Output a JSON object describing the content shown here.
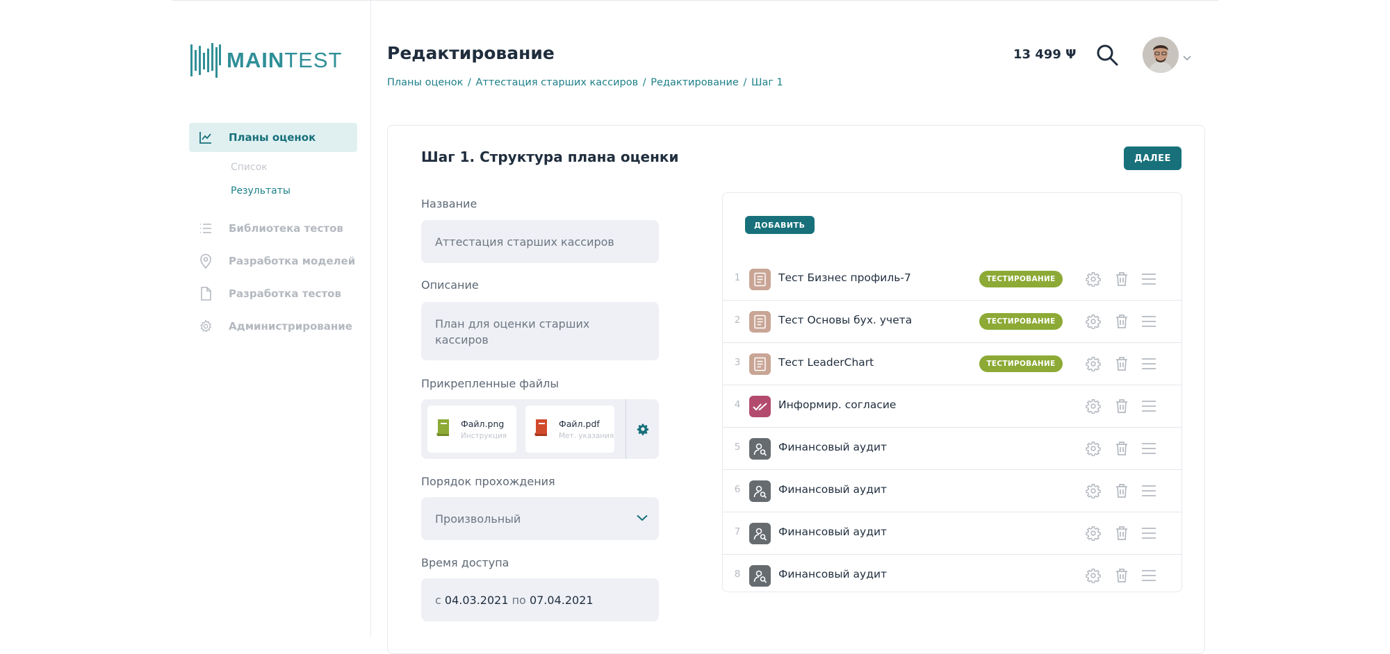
{
  "app": {
    "logo_text_bold": "MAIN",
    "logo_text_light": "TEST"
  },
  "sidebar": {
    "items": [
      {
        "label": "Планы оценок",
        "icon": "chart-line-icon",
        "active": true
      },
      {
        "label": "Библиотека тестов",
        "icon": "list-icon"
      },
      {
        "label": "Разработка моделей",
        "icon": "location-pin-icon"
      },
      {
        "label": "Разработка тестов",
        "icon": "document-icon"
      },
      {
        "label": "Администрирование",
        "icon": "gear-icon"
      }
    ],
    "subitems": [
      {
        "label": "Список"
      },
      {
        "label": "Результаты"
      }
    ]
  },
  "header": {
    "title": "Редактирование",
    "breadcrumb": [
      "Планы оценок",
      "Аттестация старших кассиров",
      "Редактирование",
      "Шаг 1"
    ],
    "breadcrumb_sep": "/",
    "balance": "13 499 Ψ"
  },
  "step": {
    "title": "Шаг 1. Структура плана оценки",
    "next_label": "ДАЛЕЕ"
  },
  "form": {
    "name_label": "Название",
    "name_value": "Аттестация старших кассиров",
    "desc_label": "Описание",
    "desc_value": "План для оценки старших кассиров",
    "files_label": "Прикрепленные файлы",
    "files": [
      {
        "name": "Файл.png",
        "desc": "Инструкция",
        "color": "#8caa35"
      },
      {
        "name": "Файл.pdf",
        "desc": "Мет. указания",
        "color": "#d24a2c"
      }
    ],
    "order_label": "Порядок прохождения",
    "order_value": "Произвольный",
    "time_label": "Время доступа",
    "time_from_prefix": "с",
    "time_from": "04.03.2021",
    "time_to_prefix": "по",
    "time_to": "07.04.2021"
  },
  "tests": {
    "add_label": "ДОБАВИТЬ",
    "rows": [
      {
        "num": "1",
        "name": "Тест Бизнес профиль-7",
        "icon": "test-document-icon",
        "badge": "ТЕСТИРОВАНИЕ"
      },
      {
        "num": "2",
        "name": "Тест Основы бух. учета",
        "icon": "test-document-icon",
        "badge": "ТЕСТИРОВАНИЕ"
      },
      {
        "num": "3",
        "name": "Тест LeaderChart",
        "icon": "test-document-icon",
        "badge": "ТЕСТИРОВАНИЕ"
      },
      {
        "num": "4",
        "name": "Информир. согласие",
        "icon": "double-check-icon",
        "badge": ""
      },
      {
        "num": "5",
        "name": "Финансовый аудит",
        "icon": "user-search-icon",
        "badge": ""
      },
      {
        "num": "6",
        "name": "Финансовый аудит",
        "icon": "user-search-icon",
        "badge": ""
      },
      {
        "num": "7",
        "name": "Финансовый аудит",
        "icon": "user-search-icon",
        "badge": ""
      },
      {
        "num": "8",
        "name": "Финансовый аудит",
        "icon": "user-search-icon",
        "badge": ""
      }
    ]
  },
  "colors": {
    "accent": "#17707a",
    "badge": "#8caa35",
    "test_icon": "#c9a596",
    "consent_icon": "#b34b6e",
    "audit_icon": "#666b70"
  }
}
